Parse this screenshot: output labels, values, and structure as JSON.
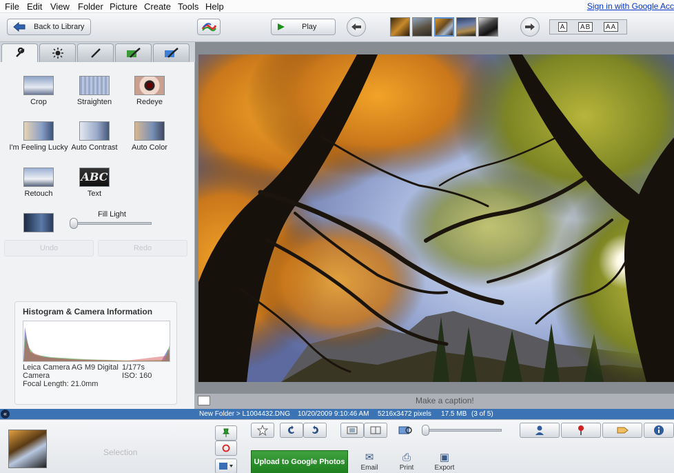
{
  "menu": [
    "File",
    "Edit",
    "View",
    "Folder",
    "Picture",
    "Create",
    "Tools",
    "Help"
  ],
  "signin": "Sign in with Google Acc",
  "toolbar": {
    "back_label": "Back to Library",
    "play_label": "Play",
    "view_modes": [
      "A",
      "AB",
      "AA"
    ]
  },
  "tabs": [
    {
      "name": "basic-fixes",
      "icon": "wrench-icon"
    },
    {
      "name": "tuning",
      "icon": "sun-icon"
    },
    {
      "name": "effects",
      "icon": "brush-icon"
    },
    {
      "name": "effects-2",
      "icon": "brush-landscape-icon"
    },
    {
      "name": "effects-3",
      "icon": "brush-sky-icon"
    }
  ],
  "tools": {
    "crop": "Crop",
    "straighten": "Straighten",
    "redeye": "Redeye",
    "lucky": "I'm Feeling Lucky",
    "auto_contrast": "Auto Contrast",
    "auto_color": "Auto Color",
    "retouch": "Retouch",
    "text": "Text",
    "text_icon_label": "ABC",
    "fill_light": "Fill Light",
    "fill_light_level": 0
  },
  "undo_label": "Undo",
  "redo_label": "Redo",
  "histogram": {
    "title": "Histogram & Camera Information",
    "camera": "Leica Camera AG M9 Digital Camera",
    "focal_length": "Focal Length: 21.0mm",
    "shutter": "1/177s",
    "iso": "ISO: 160"
  },
  "caption_placeholder": "Make a caption!",
  "status": {
    "path": "New Folder > L1004432.DNG",
    "datetime": "10/20/2009 9:10:46 AM",
    "dimensions": "5216x3472 pixels",
    "size": "17.5 MB",
    "position": "(3 of 5)"
  },
  "tray": {
    "selection_label": "Selection",
    "upload_label": "Upload to Google Photos",
    "email_label": "Email",
    "print_label": "Print",
    "export_label": "Export"
  }
}
